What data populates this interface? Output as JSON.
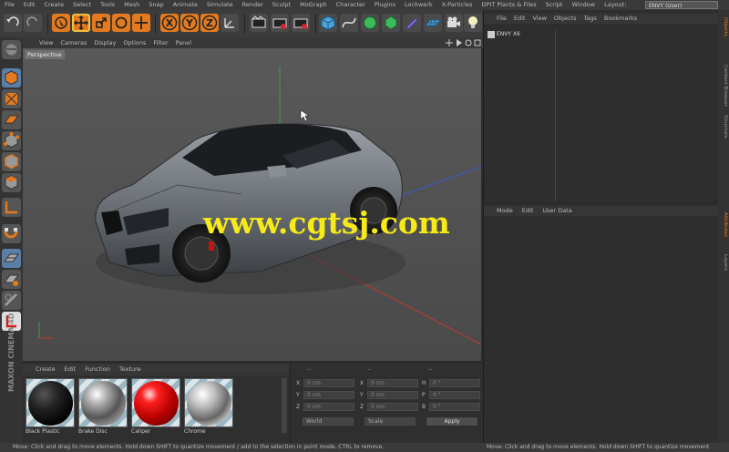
{
  "menu": {
    "items": [
      "File",
      "Edit",
      "Create",
      "Select",
      "Tools",
      "Mesh",
      "Snap",
      "Animate",
      "Simulate",
      "Render",
      "Sculpt",
      "MoGraph",
      "Character",
      "Plugins",
      "Lockwerk",
      "X-Particles",
      "DPIT Plants & Files",
      "Script",
      "Window",
      "Layout:"
    ],
    "layout_value": "ENVY (User)"
  },
  "viewport": {
    "menu": [
      "View",
      "Cameras",
      "Display",
      "Options",
      "Filter",
      "Panel"
    ],
    "label": "Perspective"
  },
  "watermark": "www.cgtsj.com",
  "material_manager": {
    "menu": [
      "Create",
      "Edit",
      "Function",
      "Texture"
    ],
    "materials": [
      {
        "name": "Black Plastic"
      },
      {
        "name": "Brake Disc"
      },
      {
        "name": "Caliper"
      },
      {
        "name": "Chrome"
      }
    ]
  },
  "coordinates": {
    "header": [
      "--",
      "--",
      "--"
    ],
    "rows": [
      {
        "axis": "X",
        "pos": "0 cm",
        "size_axis": "X",
        "size": "0 cm",
        "rot_axis": "H",
        "rot": "0 °"
      },
      {
        "axis": "Y",
        "pos": "0 cm",
        "size_axis": "Y",
        "size": "0 cm",
        "rot_axis": "P",
        "rot": "0 °"
      },
      {
        "axis": "Z",
        "pos": "0 cm",
        "size_axis": "Z",
        "size": "0 cm",
        "rot_axis": "B",
        "rot": "0 °"
      }
    ],
    "mode": "World",
    "scale_mode": "Scale",
    "apply": "Apply"
  },
  "object_manager": {
    "menu": [
      "File",
      "Edit",
      "View",
      "Objects",
      "Tags",
      "Bookmarks"
    ],
    "object": "ENVY X6"
  },
  "attribute_manager": {
    "menu": [
      "Mode",
      "Edit",
      "User Data"
    ]
  },
  "right_tabs": [
    "Objects",
    "Content Browser",
    "Structure"
  ],
  "right_tabs_lower": [
    "Attributes",
    "Layers"
  ],
  "brand": "MAXON CINEMA 4D",
  "status": "Move: Click and drag to move elements. Hold down SHIFT to quantize movement / add to the selection in point mode, CTRL to remove.",
  "status_right": "Move: Click and drag to move elements. Hold down SHIFT to quantize movement",
  "colors": {
    "accent": "#e37a1f",
    "watermark": "#f7ea16",
    "selected": "#4a7da8"
  }
}
